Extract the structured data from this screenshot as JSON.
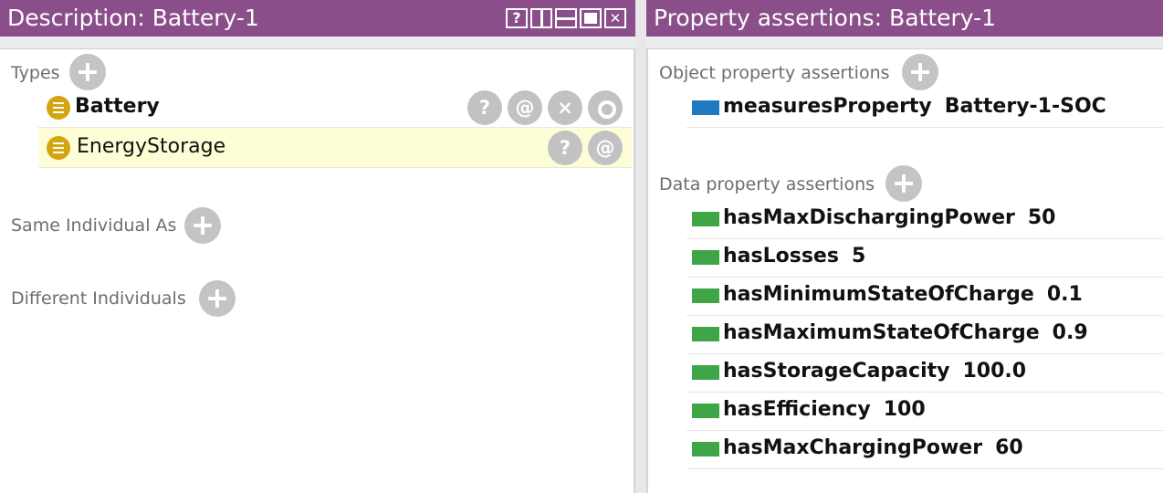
{
  "left": {
    "title": "Description: Battery-1",
    "types_label": "Types",
    "types": [
      {
        "name": "Battery",
        "actions": [
          "?",
          "@",
          "×",
          "o"
        ]
      },
      {
        "name": "EnergyStorage",
        "actions": [
          "?",
          "@"
        ]
      }
    ],
    "same_individual_label": "Same Individual As",
    "different_individuals_label": "Different Individuals"
  },
  "right": {
    "title": "Property assertions: Battery-1",
    "object_label": "Object property assertions",
    "object_props": [
      {
        "name": "measuresProperty",
        "value": "Battery-1-SOC"
      }
    ],
    "data_label": "Data property assertions",
    "data_props": [
      {
        "name": "hasMaxDischargingPower",
        "value": "50"
      },
      {
        "name": "hasLosses",
        "value": "5"
      },
      {
        "name": "hasMinimumStateOfCharge",
        "value": "0.1"
      },
      {
        "name": "hasMaximumStateOfCharge",
        "value": "0.9"
      },
      {
        "name": "hasStorageCapacity",
        "value": "100.0"
      },
      {
        "name": "hasEfficiency",
        "value": "100"
      },
      {
        "name": "hasMaxChargingPower",
        "value": "60"
      }
    ]
  },
  "colors": {
    "titlebar": "#8a4e8a",
    "class_icon": "#d3a50f",
    "object_property": "#1f79c0",
    "data_property": "#3fa647",
    "highlight": "#fdfdd6"
  }
}
